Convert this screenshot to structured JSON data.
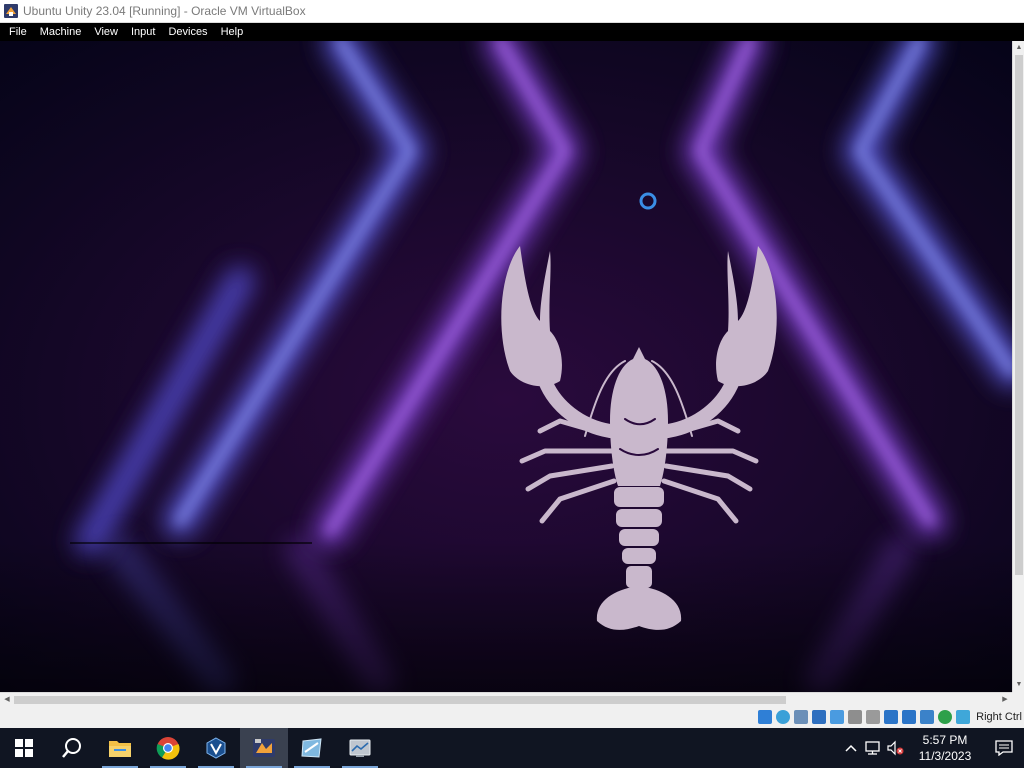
{
  "window": {
    "title": "Ubuntu Unity 23.04 [Running] - Oracle VM VirtualBox"
  },
  "menu": {
    "items": [
      "File",
      "Machine",
      "View",
      "Input",
      "Devices",
      "Help"
    ]
  },
  "statusbar": {
    "host_key": "Right Ctrl",
    "icons": [
      "hard-disk-icon",
      "optical-drive-icon",
      "audio-icon",
      "network-icon",
      "usb-icon",
      "shared-folders-icon",
      "display-icon",
      "video-capture-icon",
      "cpu-icon",
      "mouse-integration-icon",
      "keyboard-icon"
    ]
  },
  "taskbar": {
    "apps": [
      "start-icon",
      "search-icon",
      "file-explorer-icon",
      "chrome-icon",
      "virtualbox-manager-icon",
      "virtualbox-vm-icon",
      "app-icon",
      "app-icon-2"
    ],
    "time": "5:57 PM",
    "date": "11/3/2023"
  },
  "colors": {
    "accent": "#3a8ee6",
    "wallpaper_bg": "#0a0524",
    "lobster": "#c9b8cc",
    "taskbar": "#101522"
  }
}
